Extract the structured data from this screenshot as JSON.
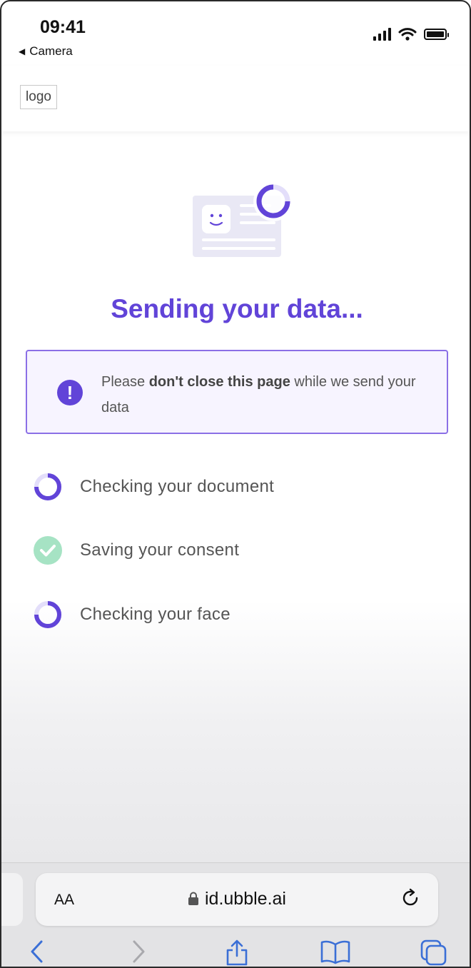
{
  "status_bar": {
    "time": "09:41",
    "back_label": "Camera"
  },
  "header": {
    "logo_text": "logo"
  },
  "main": {
    "title": "Sending your data...",
    "alert": {
      "prefix": "Please ",
      "bold": "don't close this page",
      "suffix": " while we send your data"
    },
    "steps": [
      {
        "label": "Checking your document",
        "status": "in-progress"
      },
      {
        "label": "Saving your consent",
        "status": "done"
      },
      {
        "label": "Checking your face",
        "status": "in-progress"
      }
    ]
  },
  "browser": {
    "aa_label": "AA",
    "url": "id.ubble.ai"
  },
  "colors": {
    "accent": "#6144d8",
    "success": "#7fd6a8",
    "alert_border": "#8b6fe6"
  }
}
